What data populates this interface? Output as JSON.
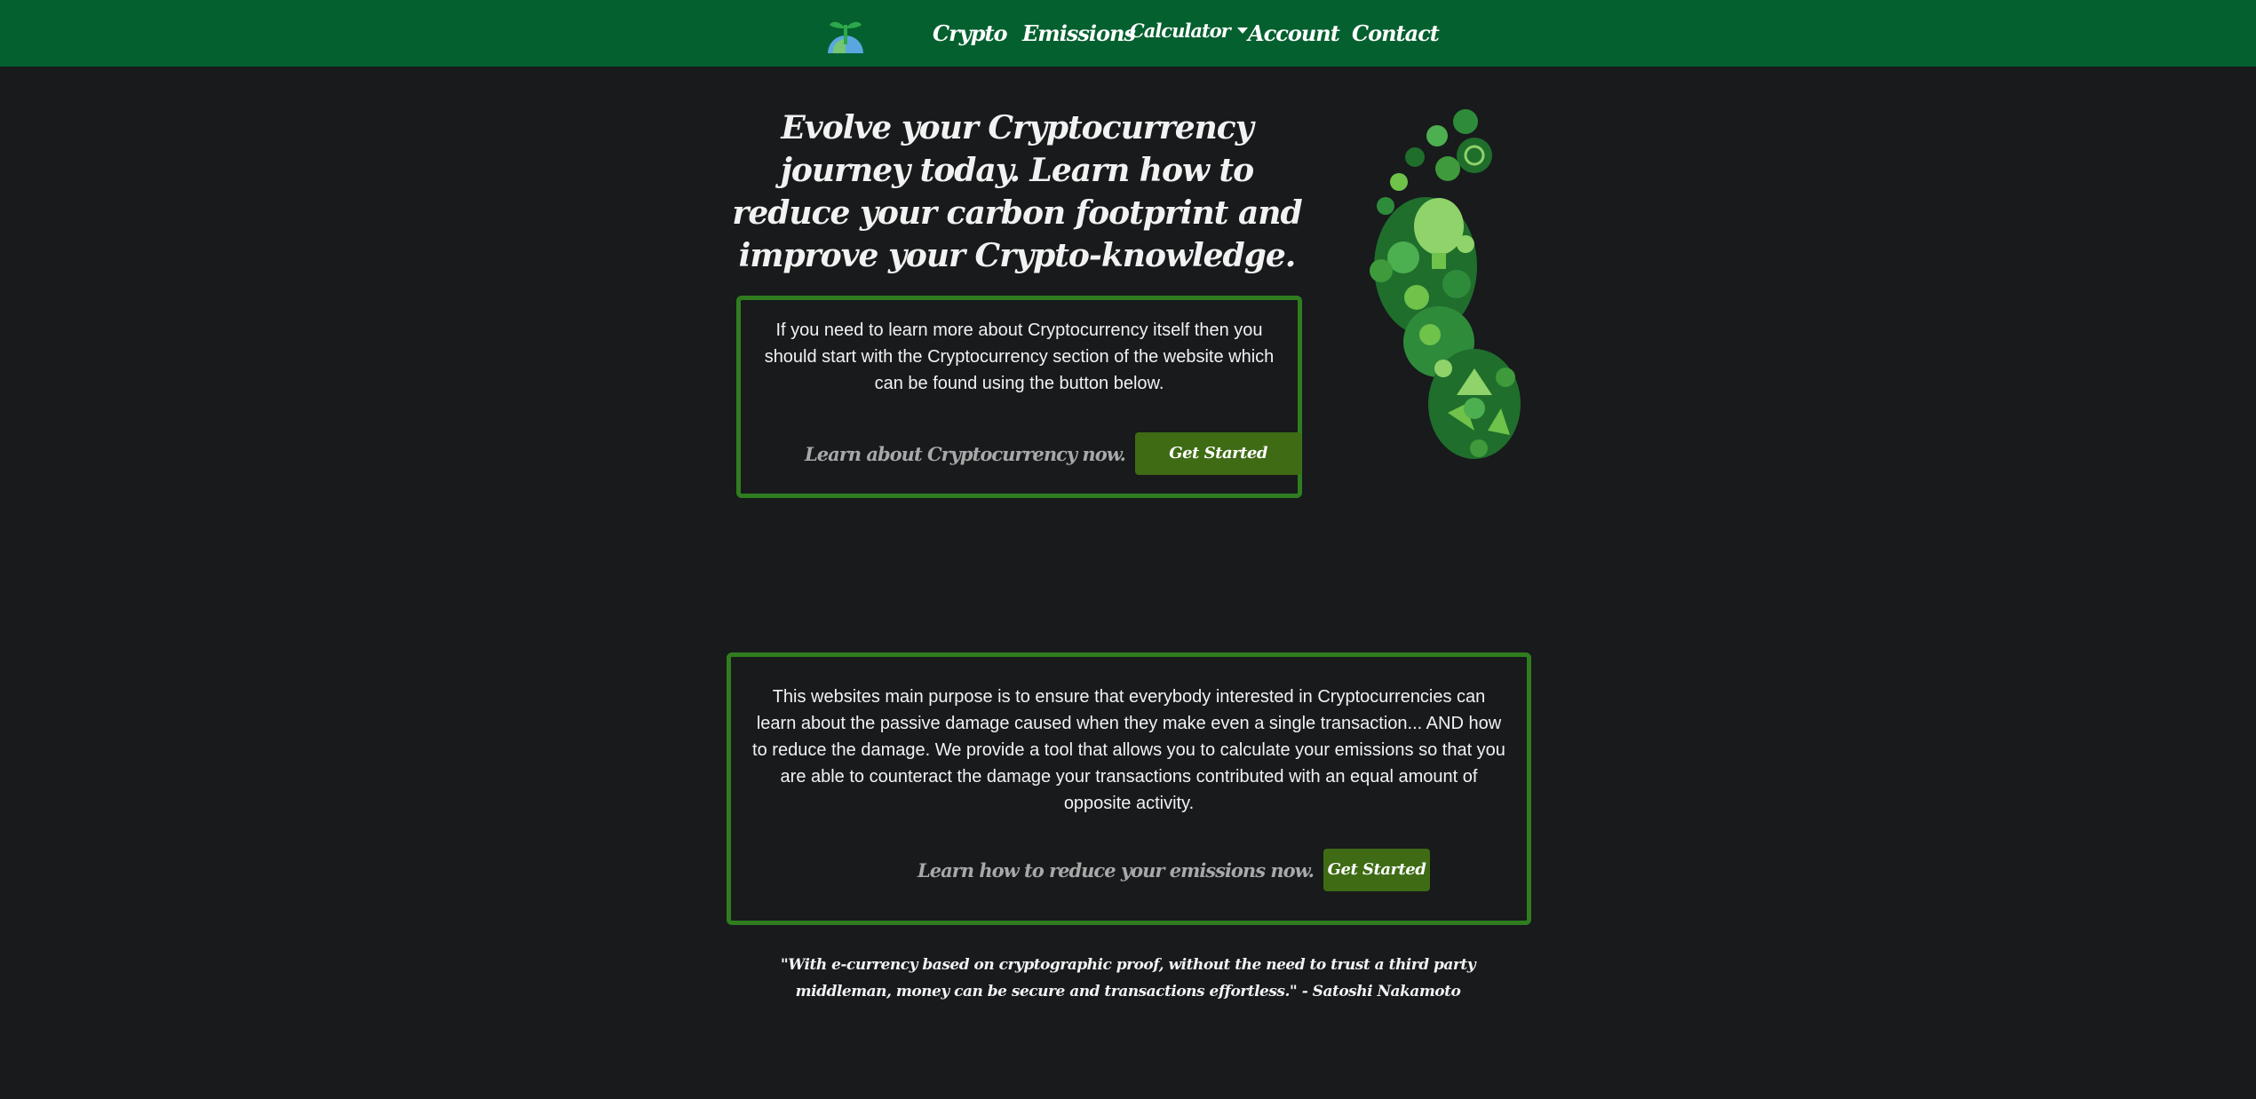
{
  "nav": {
    "logo_icon": "sprout-globe-logo",
    "items": [
      {
        "label": "Crypto"
      },
      {
        "label": "Emissions"
      },
      {
        "label": "Calculator",
        "dropdown": true
      },
      {
        "label": "Account"
      },
      {
        "label": "Contact"
      }
    ]
  },
  "hero": {
    "title": "Evolve your Cryptocurrency journey today. Learn how to reduce your carbon footprint and improve your Crypto-knowledge.",
    "image_icon": "green-eco-footprint"
  },
  "crypto_box": {
    "text": "If you need to learn more about Cryptocurrency itself then you should start with the Cryptocurrency section of the website which can be found using the button below.",
    "cta_text": "Learn about Cryptocurrency now.",
    "button_label": "Get Started"
  },
  "emissions_box": {
    "text": "This websites main purpose is to ensure that everybody interested in Cryptocurrencies can learn about the passive damage caused when they make even a single transaction... AND how to reduce the damage. We provide a tool that allows you to calculate your emissions so that you are able to counteract the damage your transactions contributed with an equal amount of opposite activity.",
    "cta_text": "Learn how to reduce your emissions now.",
    "button_label": "Get Started"
  },
  "quote": {
    "text": "\"With e-currency based on cryptographic proof, without the need to trust a third party middleman, money can be secure and transactions effortless.\" - Satoshi Nakamoto"
  },
  "colors": {
    "navbar": "#04602f",
    "background": "#181a1c",
    "box_border": "#2f7d1f",
    "button": "#3e6b14"
  }
}
